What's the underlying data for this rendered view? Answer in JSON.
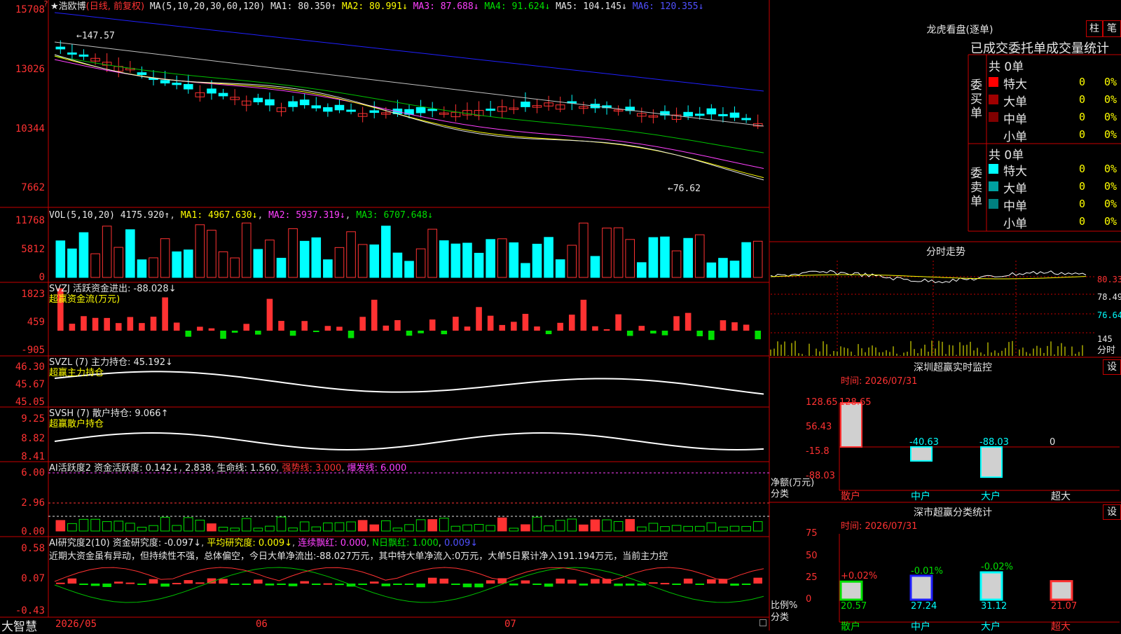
{
  "stock": {
    "name": "★浩欧博",
    "mode": "(日线, 前复权)",
    "ma_label": "MA(5,10,20,30,60,120)",
    "ma1": "MA1: 80.350↑",
    "ma2": "MA2: 80.991↓",
    "ma3": "MA3: 87.688↓",
    "ma4": "MA4: 91.624↓",
    "ma5": "MA5: 104.145↓",
    "ma6": "MA6: 120.355↓",
    "high_mark": "147.57",
    "low_mark": "76.62",
    "y_ticks": [
      "15708",
      "13026",
      "10344",
      "7662"
    ],
    "top_mark": "?"
  },
  "vol": {
    "label": "VOL(5,10,20)",
    "value": "4175.920↑",
    "ma1": "MA1: 4967.630↓",
    "ma2": "MA2: 5937.319↓",
    "ma3": "MA3: 6707.648↓",
    "y_ticks": [
      "11768",
      "5812",
      "0"
    ]
  },
  "svzj": {
    "label": "SVZJ  活跃资金进出: -88.028↓",
    "sub": "超赢资金流(万元)",
    "y_ticks": [
      "1823",
      "459",
      "-905"
    ]
  },
  "svzl": {
    "label": "SVZL (7) 主力持仓: 45.192↓",
    "sub": "超赢主力持仓",
    "y_ticks": [
      "46.30",
      "45.67",
      "45.05"
    ]
  },
  "svsh": {
    "label": "SVSH (7) 散户持仓: 9.066↑",
    "sub": "超赢散户持仓",
    "y_ticks": [
      "9.25",
      "8.82",
      "8.41"
    ]
  },
  "ai1": {
    "label": "AI活跃度2 资金活跃度: 0.142↓",
    "v2": "2.838",
    "v3": "生命线: 1.560",
    "v4": "强势线: 3.000",
    "v5": "爆发线: 6.000",
    "y_ticks": [
      "6.00",
      "2.96",
      "0.00"
    ]
  },
  "ai2": {
    "label": "AI研究度2(10) 资金研究度: -0.097↓",
    "v2": "平均研究度: 0.009↓",
    "v3": "连续飘红: 0.000",
    "v4": "N日飘红: 1.000",
    "v5": "0.009↓",
    "comment": "近期大资金虽有异动，但持续性不强，总体偏空，今日大单净流出:-88.027万元，其中特大单净流入:0万元，大单5日累计净入191.194万元，当前主力控",
    "y_ticks": [
      "0.58",
      "0.07",
      "-0.43"
    ]
  },
  "bottom": {
    "brand": "大智慧",
    "dates": [
      "2026/05",
      "06",
      "07"
    ]
  },
  "dragon": {
    "title": "龙虎看盘(逐单)",
    "tab1": "柱",
    "tab2": "笔",
    "header": "已成交委托单成交量统计",
    "buy_label": "委买单",
    "sell_label": "委卖单",
    "buy_total": "共 0单",
    "sell_total": "共 0单",
    "buy_rows": [
      {
        "name": "特大",
        "count": "0",
        "pct": "0%",
        "color": "#ff0000"
      },
      {
        "name": "大单",
        "count": "0",
        "pct": "0%",
        "color": "#a00000"
      },
      {
        "name": "中单",
        "count": "0",
        "pct": "0%",
        "color": "#800000"
      },
      {
        "name": "小单",
        "count": "0",
        "pct": "0%",
        "color": "#000000"
      }
    ],
    "sell_rows": [
      {
        "name": "特大",
        "count": "0",
        "pct": "0%",
        "color": "#00ffff"
      },
      {
        "name": "大单",
        "count": "0",
        "pct": "0%",
        "color": "#00a0a0"
      },
      {
        "name": "中单",
        "count": "0",
        "pct": "0%",
        "color": "#008080"
      },
      {
        "name": "小单",
        "count": "0",
        "pct": "0%",
        "color": "#000000"
      }
    ]
  },
  "intraday": {
    "title": "分时走势",
    "y_ticks": [
      "80.33",
      "78.49",
      "76.64"
    ],
    "vol_tick": "145",
    "vol_unit": "分时"
  },
  "sz_monitor": {
    "title": "深圳超赢实时监控",
    "settings": "设",
    "time": "时间: 2026/07/31",
    "y_ticks": [
      "128.65",
      "56.43",
      "-15.8",
      "-88.03"
    ],
    "y_unit": "净额(万元)",
    "x_unit": "分类",
    "categories": [
      "散户",
      "中户",
      "大户",
      "超大"
    ],
    "values": [
      "128.65",
      "-40.63",
      "-88.03",
      "0"
    ]
  },
  "sz_class": {
    "title": "深市超赢分类统计",
    "settings": "设",
    "time": "时间: 2026/07/31",
    "y_ticks": [
      "75",
      "50",
      "25",
      "0"
    ],
    "y_unit": "比例%",
    "x_unit": "分类",
    "categories": [
      "散户",
      "中户",
      "大户",
      "超大"
    ],
    "ratios": [
      "20.57",
      "27.24",
      "31.12",
      "21.07"
    ],
    "changes": [
      "+0.02%",
      "-0.01%",
      "-0.02%",
      ""
    ]
  }
}
